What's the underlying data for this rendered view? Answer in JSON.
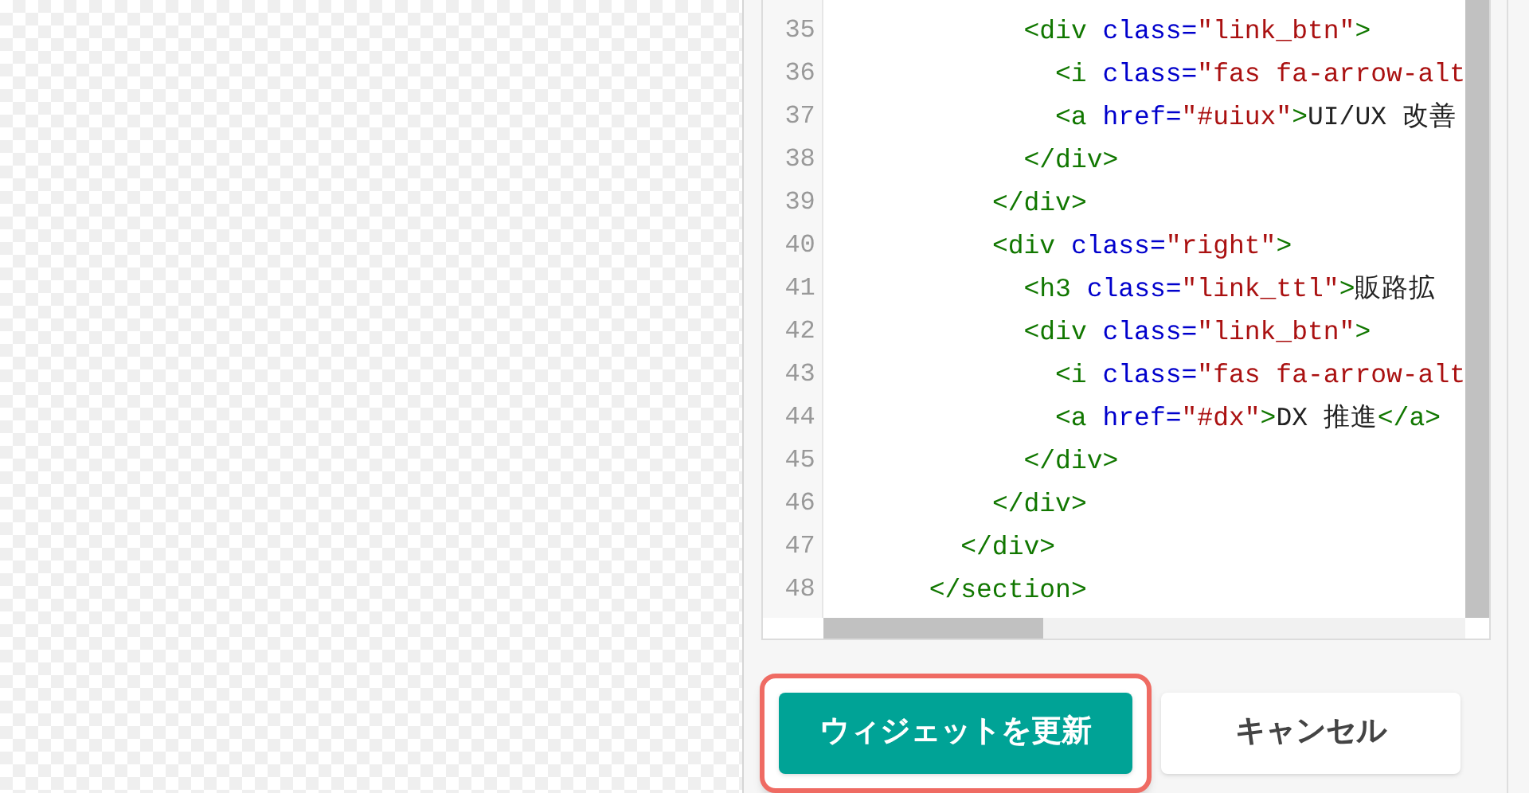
{
  "editor": {
    "lines": [
      {
        "number": "35",
        "code": "            <div class=\"link_btn\">"
      },
      {
        "number": "36",
        "code": "              <i class=\"fas fa-arrow-alt"
      },
      {
        "number": "37",
        "code": "              <a href=\"#uiux\">UI/UX 改善"
      },
      {
        "number": "38",
        "code": "            </div>"
      },
      {
        "number": "39",
        "code": "          </div>"
      },
      {
        "number": "40",
        "code": "          <div class=\"right\">"
      },
      {
        "number": "41",
        "code": "            <h3 class=\"link_ttl\">販路拡"
      },
      {
        "number": "42",
        "code": "            <div class=\"link_btn\">"
      },
      {
        "number": "43",
        "code": "              <i class=\"fas fa-arrow-alt"
      },
      {
        "number": "44",
        "code": "              <a href=\"#dx\">DX 推進</a>"
      },
      {
        "number": "45",
        "code": "            </div>"
      },
      {
        "number": "46",
        "code": "          </div>"
      },
      {
        "number": "47",
        "code": "        </div>"
      },
      {
        "number": "48",
        "code": "      </section>"
      }
    ]
  },
  "buttons": [
    {
      "label": "ウィジェットを更新",
      "kind": "primary",
      "highlighted": true
    },
    {
      "label": "キャンセル",
      "kind": "secondary",
      "highlighted": false
    }
  ]
}
